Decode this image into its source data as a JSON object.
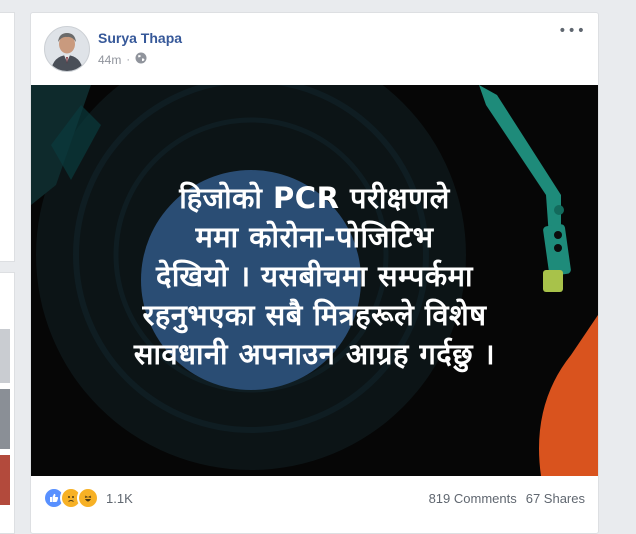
{
  "post": {
    "author": "Surya Thapa",
    "time": "44m",
    "audience_icon": "globe-icon",
    "menu_icon": "more-options-icon",
    "image_text_lines": [
      "हिजोको PCR परीक्षणले",
      "ममा कोरोना-पोजिटिभ",
      "देखियो । यसबीचमा सम्पर्कमा",
      "रहनुभएका सबै मित्रहरूले विशेष",
      "सावधानी अपनाउन आग्रह गर्दछु ।"
    ]
  },
  "footer": {
    "reaction_icons": [
      "like-icon",
      "sad-icon",
      "haha-icon"
    ],
    "reaction_count": "1.1K",
    "comments": "819 Comments",
    "shares": "67 Shares"
  },
  "colors": {
    "author_link": "#365899",
    "image_bg": "#060606",
    "disc_blue": "#2a4d74",
    "tonearm_teal": "#1e8b7a",
    "accent_orange": "#d9531e"
  }
}
